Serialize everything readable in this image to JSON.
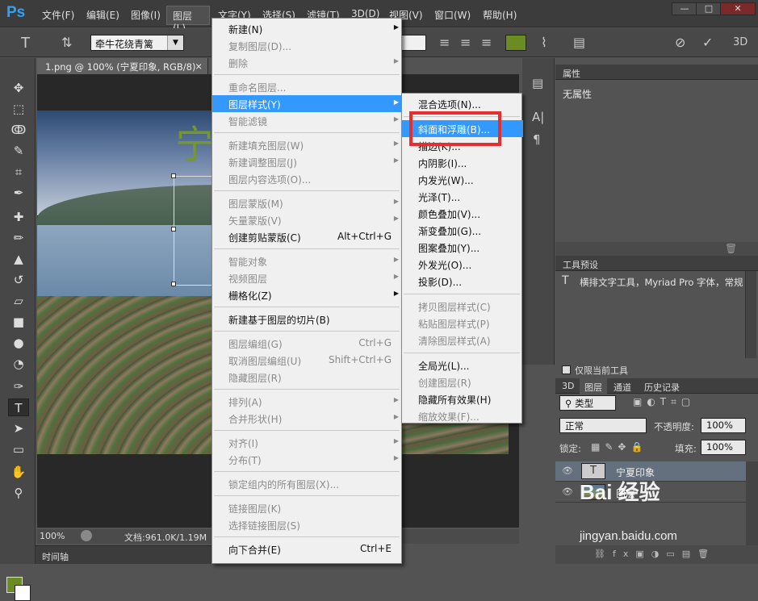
{
  "app": {
    "logo": "Ps"
  },
  "menubar": {
    "items": [
      "文件(F)",
      "编辑(E)",
      "图像(I)",
      "图层(L)",
      "文字(Y)",
      "选择(S)",
      "滤镜(T)",
      "3D(D)",
      "视图(V)",
      "窗口(W)",
      "帮助(H)"
    ],
    "window_buttons": [
      "—",
      "□",
      "✕"
    ]
  },
  "options_bar": {
    "font_family": "牵牛花绕青篱",
    "color": "#6b8c22",
    "icons": [
      "text-tool-icon",
      "text-orientation-icon",
      "align-left-icon",
      "align-center-icon",
      "align-right-icon",
      "warp-text-icon",
      "character-panel-icon",
      "cancel-icon",
      "commit-icon",
      "3d-icon"
    ],
    "btn_3d": "3D"
  },
  "toolbox": {
    "fg_color": "#6b8c22",
    "bg_color": "#ffffff"
  },
  "document": {
    "tab": "1.png @ 100% (宁夏印象, RGB/8) *",
    "tab_close": "×",
    "zoom": "100%",
    "doc_info": "文档:961.0K/1.19M"
  },
  "timeline": {
    "label": "时间轴"
  },
  "panels": {
    "properties": {
      "title": "属性",
      "body": "无属性"
    },
    "tool_presets": {
      "title": "工具预设",
      "item": "横排文字工具，Myriad Pro 字体，常规",
      "checkbox": "仅限当前工具"
    },
    "layers": {
      "tabs": [
        "3D",
        "图层",
        "通道",
        "历史记录"
      ],
      "filter": "类型",
      "blend_mode": "正常",
      "opacity_label": "不透明度:",
      "opacity": "100%",
      "lock_label": "锁定:",
      "fill_label": "填充:",
      "fill": "100%",
      "items": [
        {
          "name": "宁夏印象",
          "type": "text"
        },
        {
          "name": "图层",
          "type": "image"
        }
      ]
    }
  },
  "layer_menu": {
    "items": [
      {
        "label": "新建(N)",
        "submenu": true,
        "disabled": false
      },
      {
        "label": "复制图层(D)...",
        "disabled": true
      },
      {
        "label": "删除",
        "submenu": true,
        "disabled": true
      },
      {
        "sep": true
      },
      {
        "label": "重命名图层...",
        "disabled": true
      },
      {
        "label": "图层样式(Y)",
        "submenu": true,
        "disabled": false,
        "highlight": true
      },
      {
        "label": "智能滤镜",
        "submenu": true,
        "disabled": true
      },
      {
        "sep": true
      },
      {
        "label": "新建填充图层(W)",
        "submenu": true,
        "disabled": true
      },
      {
        "label": "新建调整图层(J)",
        "submenu": true,
        "disabled": true
      },
      {
        "label": "图层内容选项(O)...",
        "disabled": true
      },
      {
        "sep": true
      },
      {
        "label": "图层蒙版(M)",
        "submenu": true,
        "disabled": true
      },
      {
        "label": "矢量蒙版(V)",
        "submenu": true,
        "disabled": true
      },
      {
        "label": "创建剪贴蒙版(C)",
        "shortcut": "Alt+Ctrl+G",
        "disabled": false
      },
      {
        "sep": true
      },
      {
        "label": "智能对象",
        "submenu": true,
        "disabled": true
      },
      {
        "label": "视频图层",
        "submenu": true,
        "disabled": true
      },
      {
        "label": "栅格化(Z)",
        "submenu": true,
        "disabled": false
      },
      {
        "sep": true
      },
      {
        "label": "新建基于图层的切片(B)",
        "disabled": false
      },
      {
        "sep": true
      },
      {
        "label": "图层编组(G)",
        "shortcut": "Ctrl+G",
        "disabled": true
      },
      {
        "label": "取消图层编组(U)",
        "shortcut": "Shift+Ctrl+G",
        "disabled": true
      },
      {
        "label": "隐藏图层(R)",
        "disabled": true
      },
      {
        "sep": true
      },
      {
        "label": "排列(A)",
        "submenu": true,
        "disabled": true
      },
      {
        "label": "合并形状(H)",
        "submenu": true,
        "disabled": true
      },
      {
        "sep": true
      },
      {
        "label": "对齐(I)",
        "submenu": true,
        "disabled": true
      },
      {
        "label": "分布(T)",
        "submenu": true,
        "disabled": true
      },
      {
        "sep": true
      },
      {
        "label": "锁定组内的所有图层(X)...",
        "disabled": true
      },
      {
        "sep": true
      },
      {
        "label": "链接图层(K)",
        "disabled": true
      },
      {
        "label": "选择链接图层(S)",
        "disabled": true
      },
      {
        "sep": true
      },
      {
        "label": "向下合并(E)",
        "shortcut": "Ctrl+E",
        "disabled": false
      }
    ]
  },
  "style_submenu": {
    "items": [
      {
        "label": "混合选项(N)...",
        "disabled": false
      },
      {
        "sep": true
      },
      {
        "label": "斜面和浮雕(B)...",
        "disabled": false,
        "highlight": true
      },
      {
        "label": "描边(K)...",
        "disabled": false
      },
      {
        "label": "内阴影(I)...",
        "disabled": false
      },
      {
        "label": "内发光(W)...",
        "disabled": false
      },
      {
        "label": "光泽(T)...",
        "disabled": false
      },
      {
        "label": "颜色叠加(V)...",
        "disabled": false
      },
      {
        "label": "渐变叠加(G)...",
        "disabled": false
      },
      {
        "label": "图案叠加(Y)...",
        "disabled": false
      },
      {
        "label": "外发光(O)...",
        "disabled": false
      },
      {
        "label": "投影(D)...",
        "disabled": false
      },
      {
        "sep": true
      },
      {
        "label": "拷贝图层样式(C)",
        "disabled": true
      },
      {
        "label": "粘贴图层样式(P)",
        "disabled": true
      },
      {
        "label": "清除图层样式(A)",
        "disabled": true
      },
      {
        "sep": true
      },
      {
        "label": "全局光(L)...",
        "disabled": false
      },
      {
        "label": "创建图层(R)",
        "disabled": true
      },
      {
        "label": "隐藏所有效果(H)",
        "disabled": false
      },
      {
        "label": "缩放效果(F)...",
        "disabled": true
      }
    ]
  },
  "watermark": {
    "brand": "Bai 经验",
    "url": "jingyan.baidu.com"
  }
}
